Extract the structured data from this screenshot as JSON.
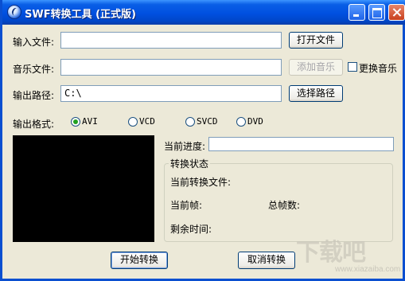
{
  "window": {
    "title": "SWF转换工具 (正式版)"
  },
  "input_file": {
    "label": "输入文件:",
    "value": "",
    "button": "打开文件"
  },
  "music_file": {
    "label": "音乐文件:",
    "value": "",
    "button": "添加音乐",
    "checkbox_label": "更换音乐",
    "checked": false
  },
  "output_path": {
    "label": "输出路径:",
    "value": "C:\\",
    "button": "选择路径"
  },
  "output_format": {
    "label": "输出格式:",
    "options": [
      "AVI",
      "VCD",
      "SVCD",
      "DVD"
    ],
    "selected": "AVI"
  },
  "progress": {
    "label": "当前进度:",
    "value": ""
  },
  "status": {
    "title": "转换状态",
    "current_file_label": "当前转换文件:",
    "current_frame_label": "当前帧:",
    "total_frames_label": "总帧数:",
    "remaining_time_label": "剩余时间:"
  },
  "actions": {
    "start": "开始转换",
    "cancel": "取消转换"
  },
  "watermark": {
    "text": "下载吧",
    "sub": "www.xiazaiba.com"
  },
  "colors": {
    "titlebar": "#0050e0",
    "window_bg": "#ece9d8",
    "preview_bg": "#000000"
  }
}
